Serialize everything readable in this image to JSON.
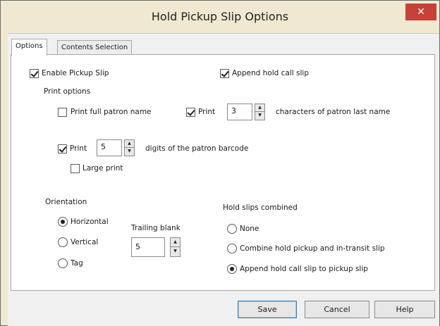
{
  "window": {
    "title": "Hold Pickup Slip Options",
    "close_glyph": "✕"
  },
  "tabs": [
    {
      "label": "Options",
      "active": true
    },
    {
      "label": "Contents Selection",
      "active": false
    }
  ],
  "options": {
    "enable_pickup_slip": {
      "label": "Enable Pickup Slip",
      "checked": true
    },
    "append_hold_call_slip": {
      "label": "Append hold call slip",
      "checked": true
    },
    "print_options_heading": "Print options",
    "print_full_patron_name": {
      "label": "Print full patron name",
      "checked": false
    },
    "print_last_name": {
      "label": "Print",
      "checked": true,
      "value": "3",
      "suffix": "characters of patron last name"
    },
    "print_barcode": {
      "label": "Print",
      "checked": true,
      "value": "5",
      "suffix": "digits of the patron barcode"
    },
    "large_print": {
      "label": "Large print",
      "checked": false
    },
    "orientation": {
      "heading": "Orientation",
      "options": [
        "Horizontal",
        "Vertical",
        "Tag"
      ],
      "selected": "Horizontal"
    },
    "trailing_blank": {
      "label": "Trailing blank",
      "value": "5"
    },
    "hold_slips_combined": {
      "heading": "Hold slips combined",
      "options": [
        "None",
        "Combine hold pickup and in-transit slip",
        "Append hold call slip to pickup slip"
      ],
      "selected": "Append hold call slip to pickup slip"
    }
  },
  "buttons": {
    "save": "Save",
    "cancel": "Cancel",
    "help": "Help"
  },
  "spinner": {
    "up": "▲",
    "down": "▼"
  }
}
